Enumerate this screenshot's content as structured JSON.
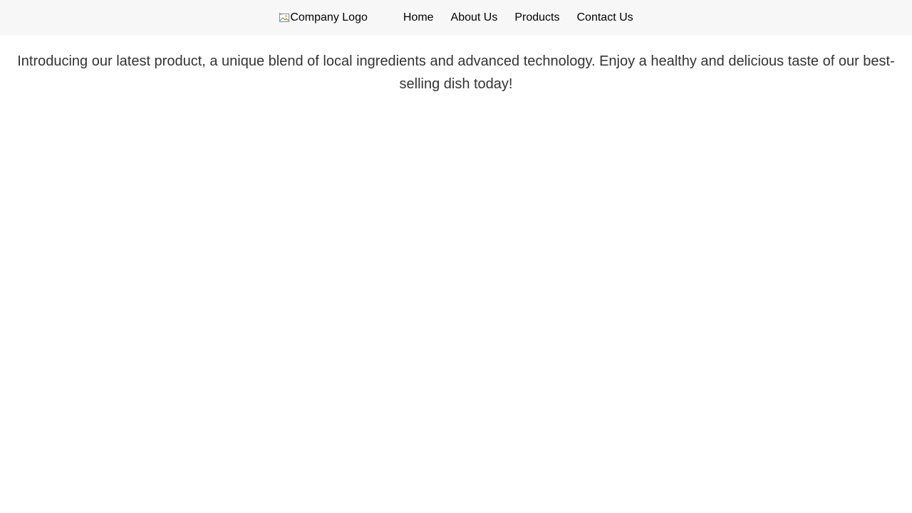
{
  "header": {
    "background": "#f7f7f7",
    "logo": {
      "alt_text": "Company Logo",
      "icon": "broken-image-icon"
    },
    "nav": [
      {
        "label": "Home"
      },
      {
        "label": "About Us"
      },
      {
        "label": "Products"
      },
      {
        "label": "Contact Us"
      }
    ]
  },
  "main": {
    "intro_text": "Introducing our latest product, a unique blend of local ingredients and advanced technology. Enjoy a healthy and delicious taste of our best-selling dish today!",
    "text_color": "#333333"
  }
}
